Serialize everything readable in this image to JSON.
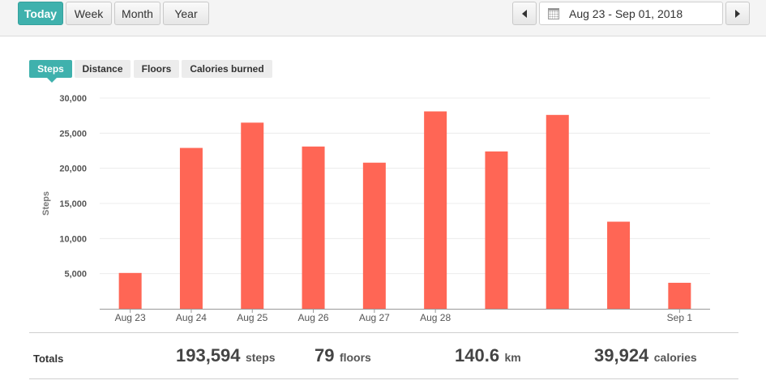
{
  "range_buttons": [
    "Today",
    "Week",
    "Month",
    "Year"
  ],
  "active_range": "Today",
  "date_range": "Aug 23 - Sep 01, 2018",
  "metric_tabs": [
    "Steps",
    "Distance",
    "Floors",
    "Calories burned"
  ],
  "active_metric": "Steps",
  "colors": {
    "accent": "#3fb1ad",
    "bar": "#ff6655"
  },
  "chart_data": {
    "type": "bar",
    "title": "",
    "ylabel": "Steps",
    "xlabel": "",
    "ylim": [
      0,
      30000
    ],
    "y_ticks": [
      "5,000",
      "10,000",
      "15,000",
      "20,000",
      "25,000",
      "30,000"
    ],
    "categories": [
      "Aug 23",
      "Aug 24",
      "Aug 25",
      "Aug 26",
      "Aug 27",
      "Aug 28",
      "",
      "",
      "",
      "Sep 1"
    ],
    "values": [
      5100,
      22900,
      26500,
      23100,
      20800,
      28100,
      22400,
      27600,
      12400,
      3700
    ],
    "grid": true
  },
  "totals": {
    "label": "Totals",
    "items": [
      {
        "value": "193,594",
        "unit": "steps"
      },
      {
        "value": "79",
        "unit": "floors"
      },
      {
        "value": "140.6",
        "unit": "km"
      },
      {
        "value": "39,924",
        "unit": "calories"
      }
    ]
  }
}
